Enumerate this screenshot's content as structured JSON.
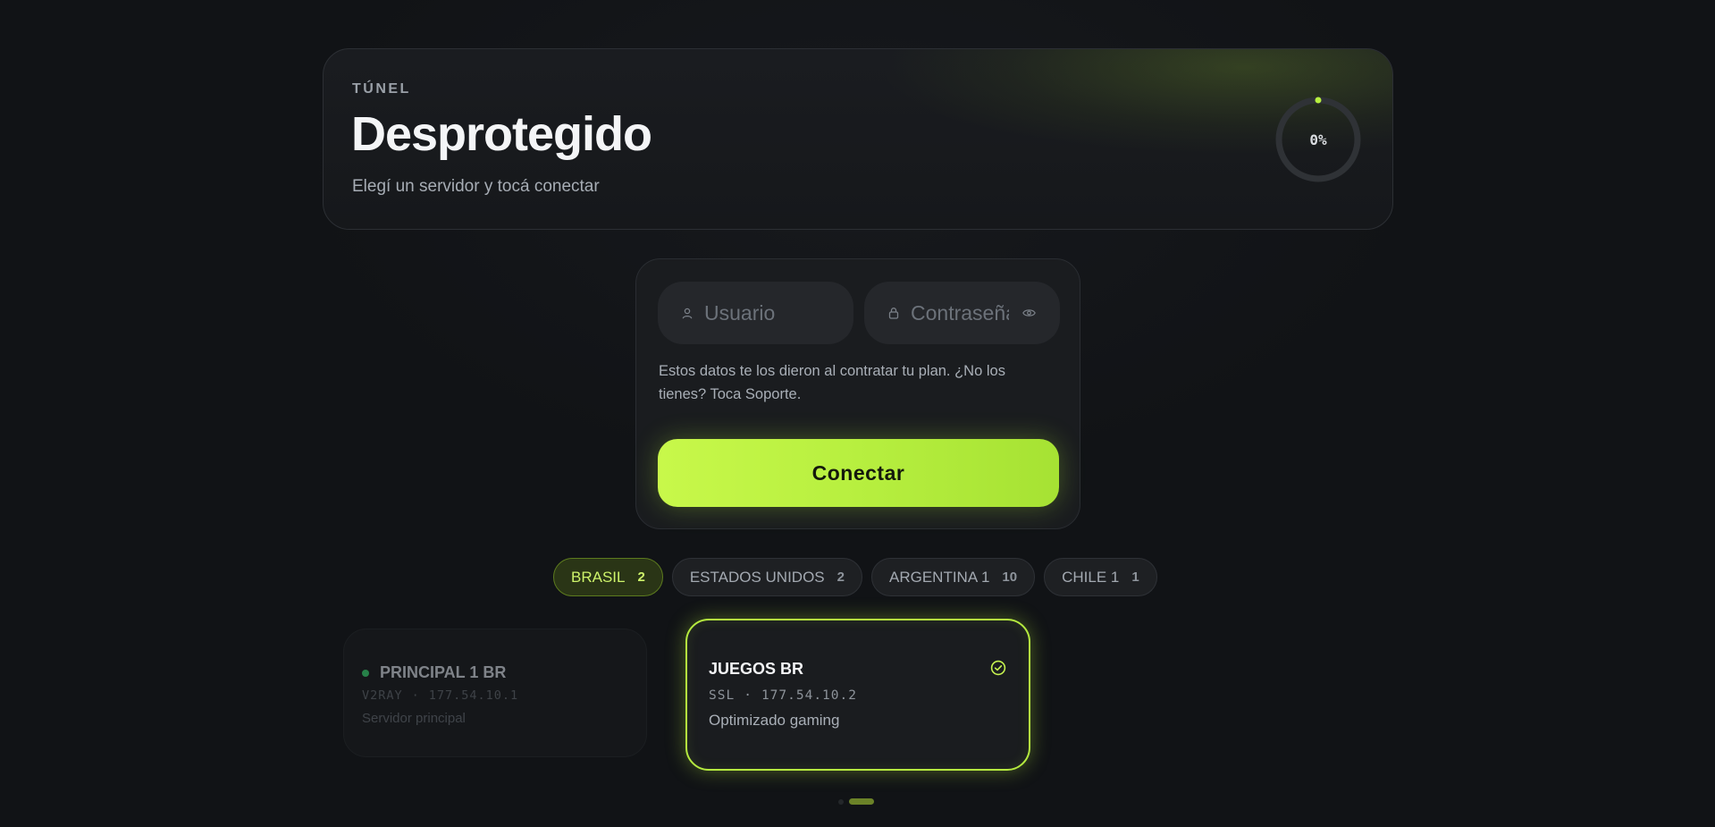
{
  "status": {
    "eyebrow": "TÚNEL",
    "title": "Desprotegido",
    "subtitle": "Elegí un servidor y tocá conectar",
    "progress_text": "0%",
    "progress_value": 0
  },
  "login": {
    "user_placeholder": "Usuario",
    "password_placeholder": "Contraseña",
    "help_text": "Estos datos te los dieron al contratar tu plan. ¿No los tienes? Toca Soporte.",
    "connect_label": "Conectar"
  },
  "tabs": [
    {
      "label": "BRASIL",
      "count": "2",
      "active": true
    },
    {
      "label": "ESTADOS UNIDOS",
      "count": "2",
      "active": false
    },
    {
      "label": "ARGENTINA 1",
      "count": "10",
      "active": false
    },
    {
      "label": "CHILE 1",
      "count": "1",
      "active": false
    }
  ],
  "servers": [
    {
      "name": "PRINCIPAL 1 BR",
      "protocol": "V2RAY",
      "separator": "·",
      "ip": "177.54.10.1",
      "description": "Servidor principal"
    },
    {
      "name": "JUEGOS BR",
      "protocol": "SSL",
      "separator": "·",
      "ip": "177.54.10.2",
      "description": "Optimizado gaming"
    }
  ],
  "colors": {
    "accent": "#b7ef3f",
    "background": "#111316",
    "status_online": "#2fa65a"
  },
  "icons": {
    "user": "user-icon",
    "lock": "lock-icon",
    "eye": "eye-icon",
    "check": "check-circle-icon"
  }
}
